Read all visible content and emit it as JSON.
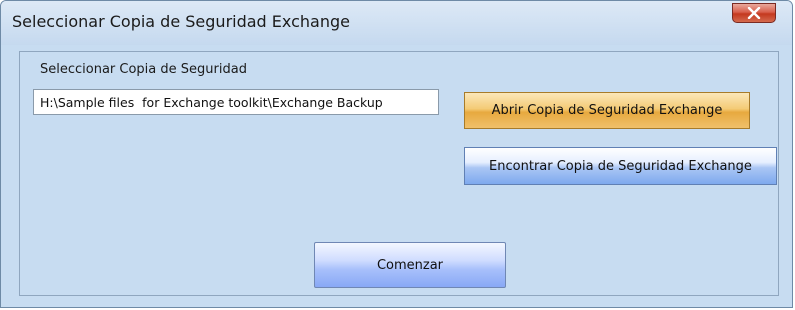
{
  "window": {
    "title": "Seleccionar Copia de Seguridad Exchange",
    "close_icon": "close-x-icon"
  },
  "form": {
    "group_label": "Seleccionar Copia de Seguridad",
    "path_value": "H:\\Sample files  for Exchange toolkit\\Exchange Backup"
  },
  "buttons": {
    "open": "Abrir Copia de Seguridad Exchange",
    "find": "Encontrar Copia de Seguridad Exchange",
    "start": "Comenzar"
  },
  "colors": {
    "window_bg": "#c7dcf1",
    "open_button": "#f4cb76",
    "find_button": "#aac6f4",
    "close_button": "#d9604d"
  }
}
